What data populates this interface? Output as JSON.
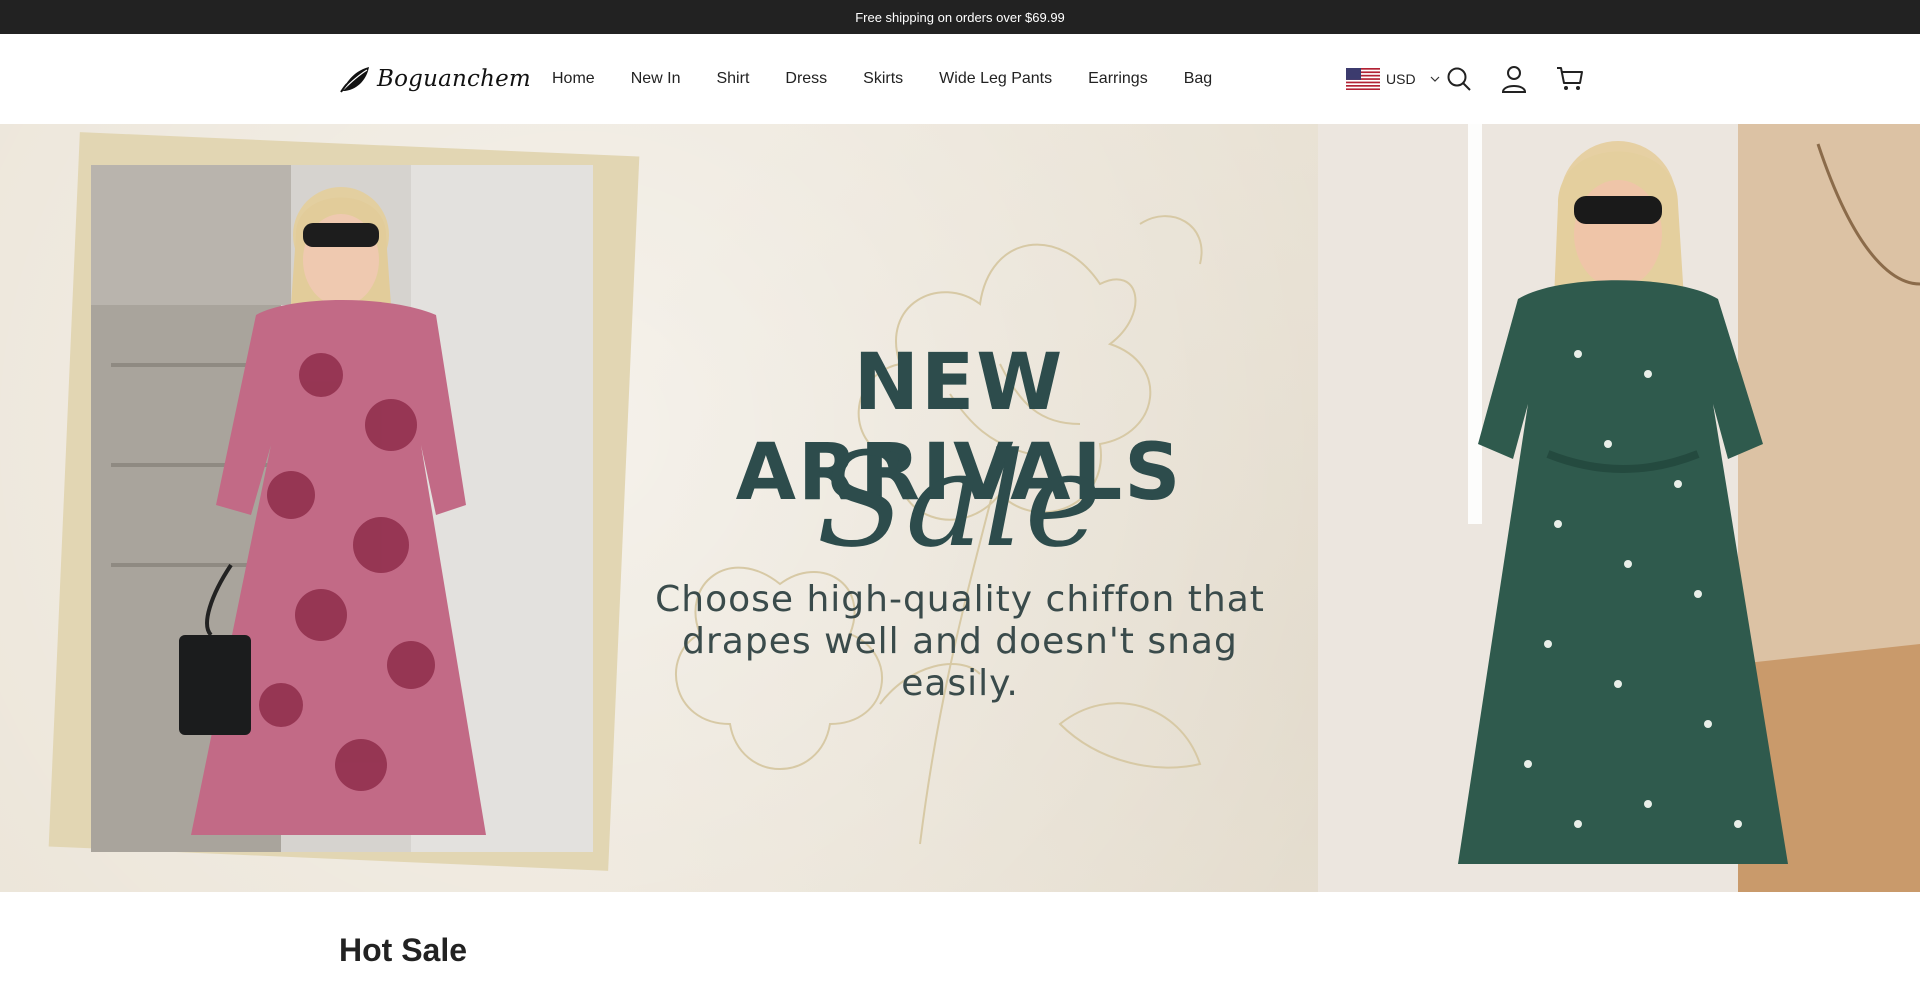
{
  "announcement": {
    "text": "Free shipping on orders over $69.99"
  },
  "brand": {
    "name": "Boguanchem"
  },
  "nav": {
    "items": [
      {
        "label": "Home"
      },
      {
        "label": "New In"
      },
      {
        "label": "Shirt"
      },
      {
        "label": "Dress"
      },
      {
        "label": "Skirts"
      },
      {
        "label": "Wide Leg Pants"
      },
      {
        "label": "Earrings"
      },
      {
        "label": "Bag"
      }
    ]
  },
  "tools": {
    "currency": "USD",
    "flag_icon": "us-flag-icon",
    "search_icon": "search-icon",
    "account_icon": "user-icon",
    "cart_icon": "cart-icon"
  },
  "hero": {
    "headline": "NEW ARRIVALS",
    "script": "Sale",
    "tagline_line1": "Choose high-quality chiffon that",
    "tagline_line2": "drapes well and doesn't snag easily."
  },
  "sections": {
    "hot_sale_title": "Hot Sale"
  },
  "colors": {
    "announce_bg": "#222222",
    "hero_text": "#2d4c4c",
    "hero_bg": "#ebe4d7",
    "pink_dress": "#c26a86",
    "green_dress": "#2f5a4d"
  }
}
